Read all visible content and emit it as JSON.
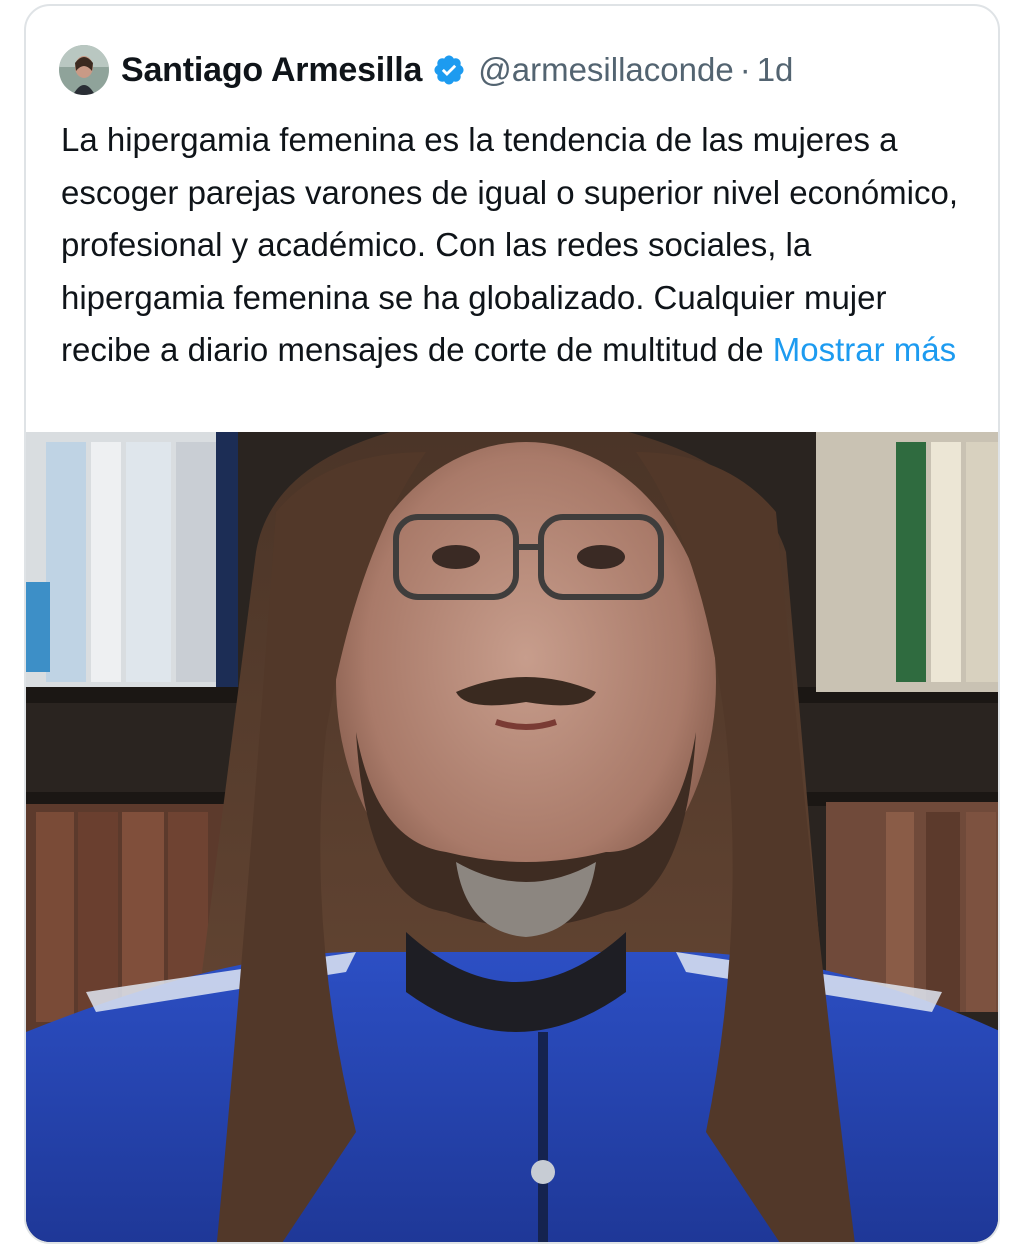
{
  "tweet": {
    "author_name": "Santiago Armesilla",
    "handle": "@armesillaconde",
    "separator": "·",
    "time": "1d",
    "text": "La hipergamia femenina es la tendencia de las mujeres a escoger parejas varones de igual o superior nivel económico, profesional y académico. Con las redes sociales, la hipergamia femenina se ha globalizado. Cualquier mujer recibe a diario mensajes de corte de multitud de",
    "show_more_label": "Mostrar más"
  },
  "icons": {
    "verified": "verified-badge-icon",
    "avatar": "avatar-photo"
  },
  "colors": {
    "verified_badge": "#1d9bf0",
    "link": "#1d9bf0",
    "jacket": "#2444b8"
  }
}
